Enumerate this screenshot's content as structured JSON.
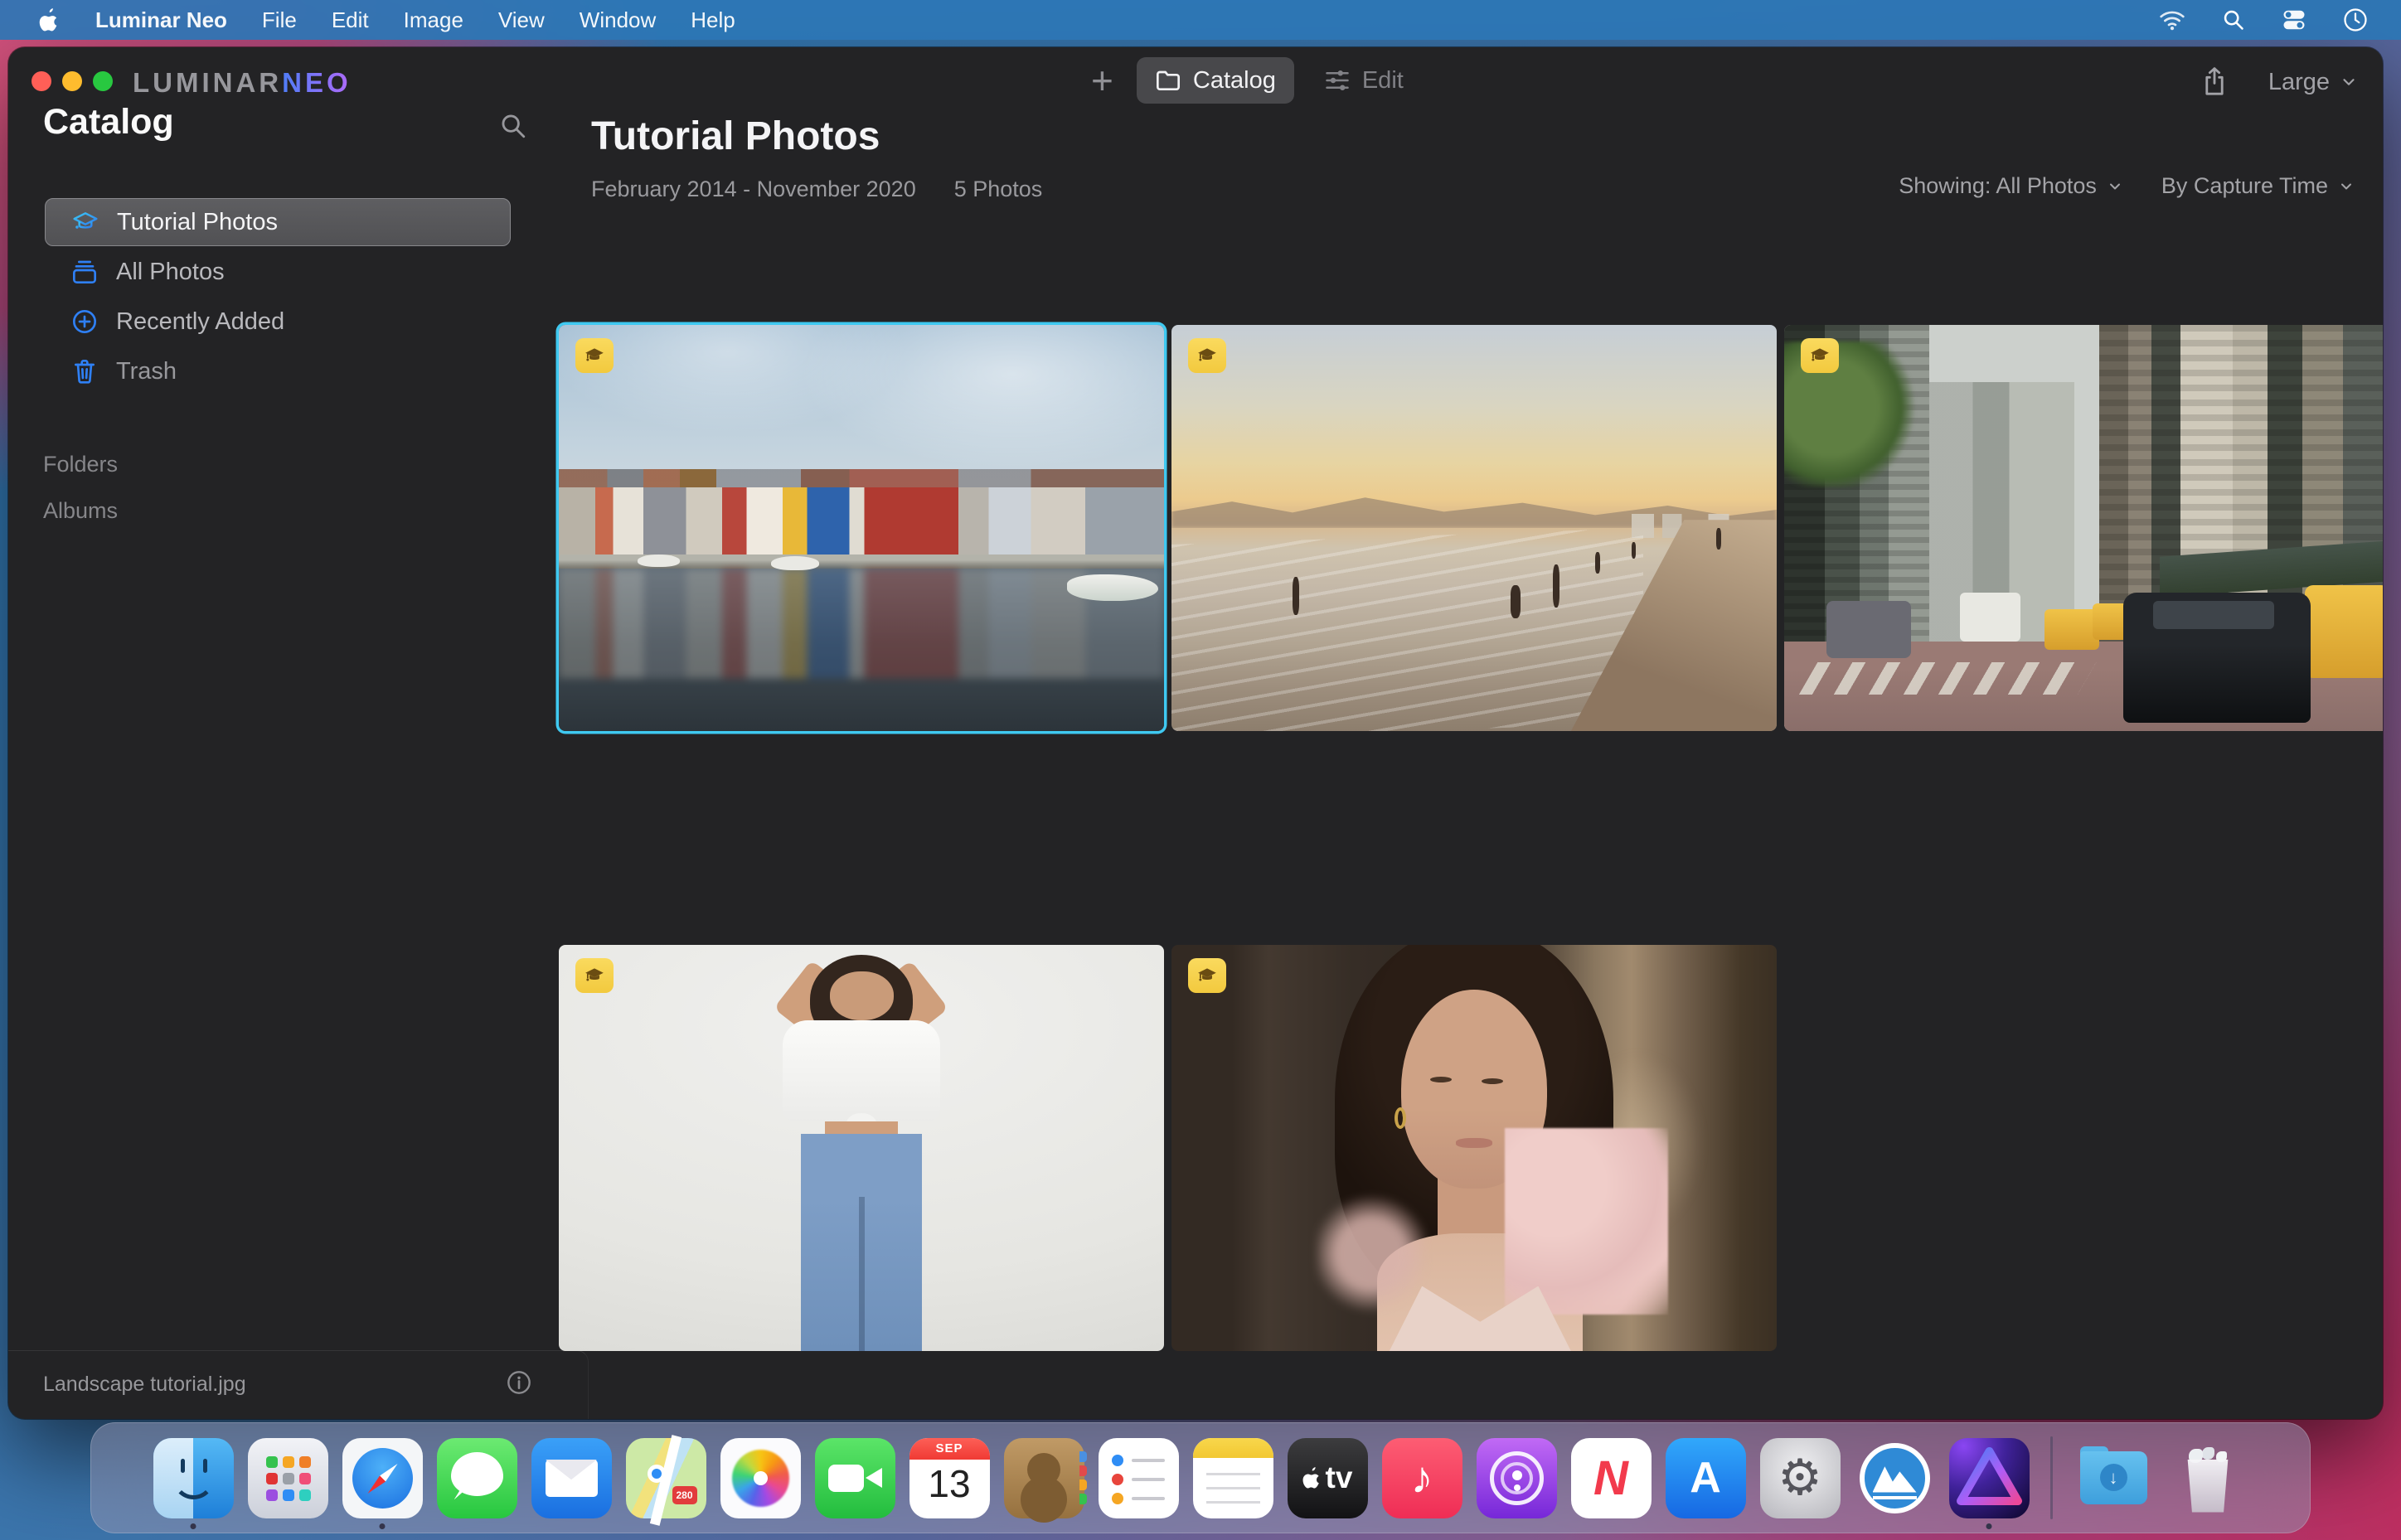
{
  "menu_bar": {
    "app_name": "Luminar Neo",
    "menus": [
      "File",
      "Edit",
      "Image",
      "View",
      "Window",
      "Help"
    ],
    "status_icons": [
      "wifi-icon",
      "spotlight-icon",
      "control-center-icon",
      "clock-icon"
    ]
  },
  "titlebar": {
    "logo_primary": "LUMINAR",
    "logo_accent": "NEO",
    "add_button": "+",
    "catalog_tab": "Catalog",
    "edit_tab": "Edit",
    "thumbnail_size": "Large"
  },
  "sidebar": {
    "title": "Catalog",
    "items": [
      {
        "label": "Tutorial Photos",
        "icon": "graduation-cap-icon",
        "selected": true
      },
      {
        "label": "All Photos",
        "icon": "photo-stack-icon",
        "selected": false
      },
      {
        "label": "Recently Added",
        "icon": "plus-circle-icon",
        "selected": false
      },
      {
        "label": "Trash",
        "icon": "trash-icon",
        "selected": false
      }
    ],
    "sections": [
      {
        "label": "Folders"
      },
      {
        "label": "Albums"
      }
    ],
    "footer": {
      "filename": "Landscape tutorial.jpg"
    }
  },
  "content": {
    "title": "Tutorial Photos",
    "date_range": "February 2014 - November 2020",
    "photo_count": "5 Photos",
    "filters": {
      "showing": "Showing: All Photos",
      "sort": "By Capture Time"
    },
    "photos": [
      {
        "description": "Colorful canal houses reflected in still water",
        "selected": true,
        "badge": "tutorial-badge"
      },
      {
        "description": "People bathing at a beach at golden sunset",
        "selected": false,
        "badge": "tutorial-badge"
      },
      {
        "description": "New York street with yellow taxis and traffic",
        "selected": false,
        "badge": "tutorial-badge"
      },
      {
        "description": "Woman in white blouse and jeans on studio background",
        "selected": false,
        "badge": "tutorial-badge"
      },
      {
        "description": "Portrait of a woman with pink tulle scrunchie",
        "selected": false,
        "badge": "tutorial-badge"
      }
    ]
  },
  "colors": {
    "selection_accent": "#3FC9F1",
    "sidebar_icon_blue": "#2F80F5",
    "badge_yellow": "#F8D254",
    "logo_gradient_start": "#4F7DF7",
    "logo_gradient_end": "#B06AF9",
    "menubar_blue": "#2C76B5"
  },
  "dock": {
    "items": [
      "Finder",
      "Launchpad",
      "Safari",
      "Messages",
      "Mail",
      "Maps",
      "Photos",
      "FaceTime",
      "Calendar",
      "Contacts",
      "Reminders",
      "Notes",
      "Apple TV",
      "Music",
      "Podcasts",
      "News",
      "App Store",
      "System Settings",
      "Luminar Share",
      "Luminar Neo",
      "Downloads",
      "Trash"
    ],
    "calendar_month": "SEP",
    "calendar_day": "13",
    "appletv_label": "tv",
    "news_letter": "N",
    "appstore_letter": "A",
    "music_glyph": "♪",
    "settings_glyph": "⚙",
    "downloads_glyph": "↓",
    "maps_shield": "280",
    "running_apps": [
      "Finder",
      "Safari",
      "Luminar Neo"
    ]
  }
}
